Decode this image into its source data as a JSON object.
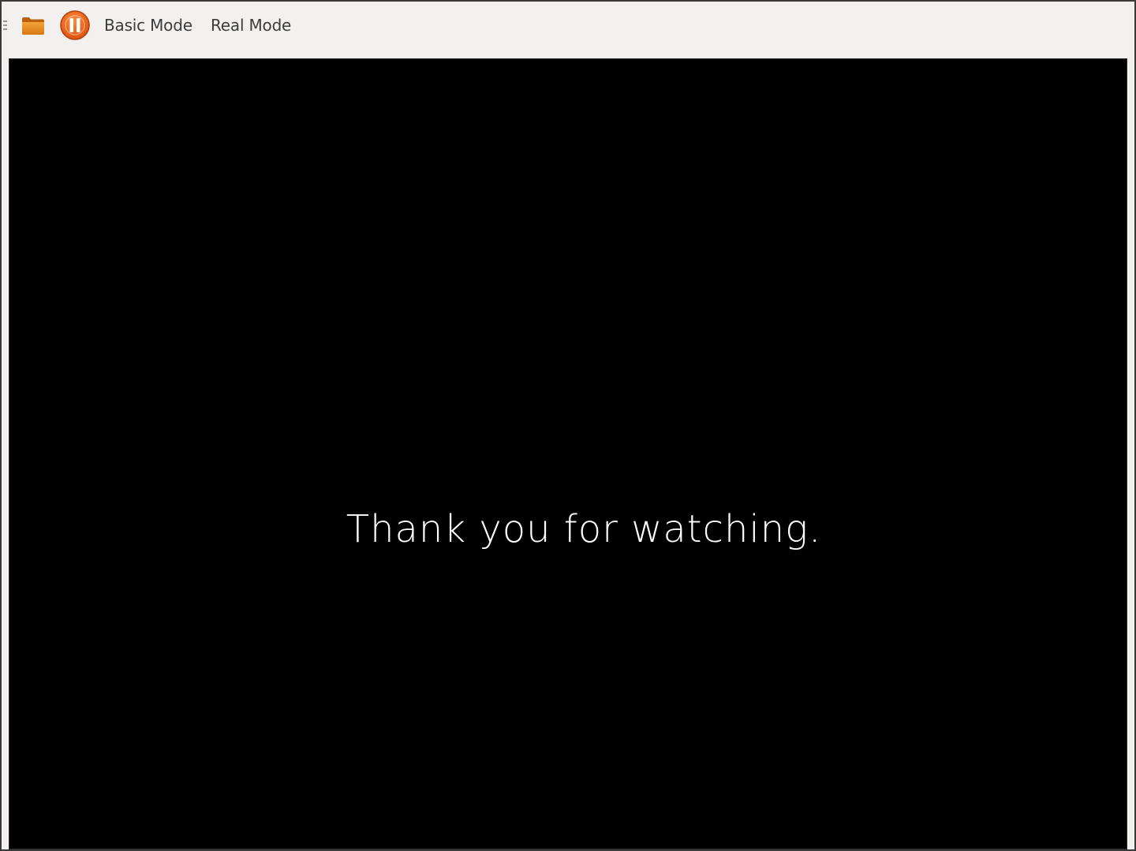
{
  "toolbar": {
    "open_icon": "folder-icon",
    "pause_icon": "pause-icon",
    "menu": [
      "Basic Mode",
      "Real Mode"
    ]
  },
  "slide": {
    "text": "Thank you for watching."
  },
  "colors": {
    "accent": "#e8641c",
    "folder": "#e08a1e",
    "viewport_bg": "#000000",
    "toolbar_bg": "#f2f1f0"
  }
}
